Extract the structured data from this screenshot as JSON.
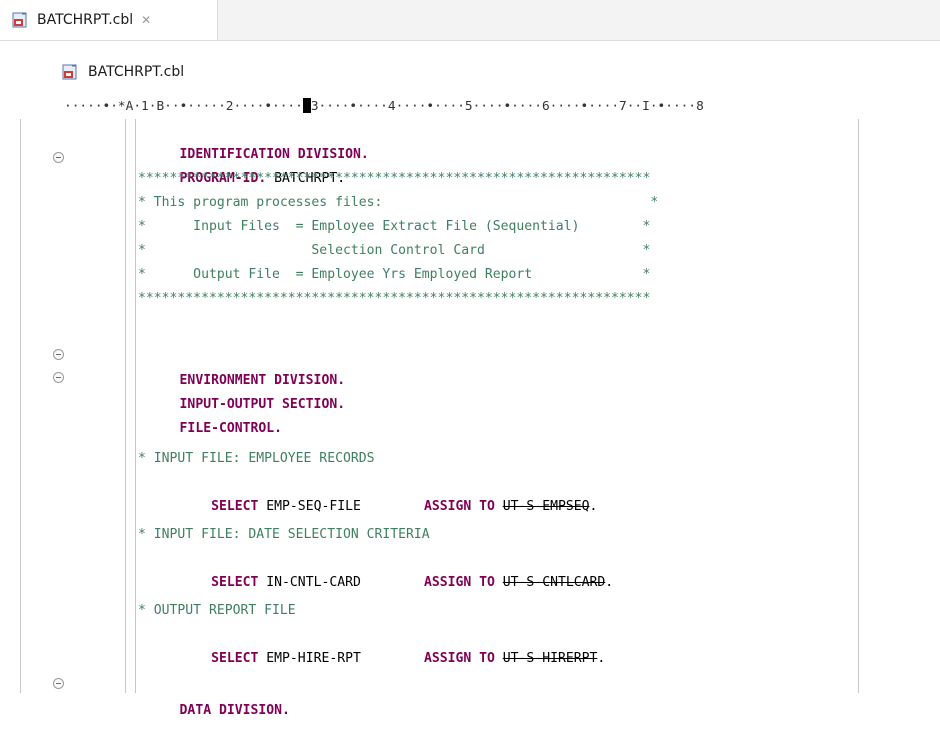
{
  "editor": {
    "tab": {
      "label": "BATCHRPT.cbl",
      "close_glyph": "✕"
    },
    "breadcrumb": {
      "label": "BATCHRPT.cbl"
    },
    "ruler": {
      "before_cursor": "·····•·*A·1·B··•·····2····•····",
      "after_cursor": "3····•····4····•····5····•····6····•····7··I·•····8"
    },
    "code": {
      "l01": {
        "kw": "IDENTIFICATION DIVISION."
      },
      "l02": {
        "kw": "PROGRAM-ID.",
        "rest": " BATCHRPT."
      },
      "l03": {
        "cm": "*****************************************************************"
      },
      "l04": {
        "cm": "* This program processes files:                                  *"
      },
      "l05": {
        "cm": "*      Input Files  = Employee Extract File (Sequential)        *"
      },
      "l06": {
        "cm": "*                     Selection Control Card                    *"
      },
      "l07": {
        "cm": "*      Output File  = Employee Yrs Employed Report              *"
      },
      "l08": {
        "cm": "*****************************************************************"
      },
      "l10": {
        "kw": "ENVIRONMENT DIVISION."
      },
      "l11": {
        "kw": "INPUT-OUTPUT SECTION."
      },
      "l12": {
        "kw": "FILE-CONTROL."
      },
      "l14": {
        "cm": "* INPUT FILE: EMPLOYEE RECORDS"
      },
      "l15": {
        "kw1": "    SELECT",
        "id": " EMP-SEQ-FILE        ",
        "kw2": "ASSIGN TO",
        "sp": " ",
        "strike": "UT-S-EMPSEQ",
        "end": "."
      },
      "l17": {
        "cm": "* INPUT FILE: DATE SELECTION CRITERIA"
      },
      "l18": {
        "kw1": "    SELECT",
        "id": " IN-CNTL-CARD        ",
        "kw2": "ASSIGN TO",
        "sp": " ",
        "strike": "UT-S-CNTLCARD",
        "end": "."
      },
      "l20": {
        "cm": "* OUTPUT REPORT FILE"
      },
      "l21": {
        "kw1": "    SELECT",
        "id": " EMP-HIRE-RPT        ",
        "kw2": "ASSIGN TO",
        "sp": " ",
        "strike": "UT-S-HIRERPT",
        "end": "."
      },
      "l23": {
        "kw": "DATA DIVISION."
      }
    },
    "icons": {
      "tab_file": "cobol-file-icon",
      "breadcrumb_file": "cobol-file-icon",
      "fold": "collapse-icon"
    },
    "colors": {
      "keyword": "#7f0055",
      "comment": "#3f7f5f",
      "text": "#000000"
    }
  }
}
